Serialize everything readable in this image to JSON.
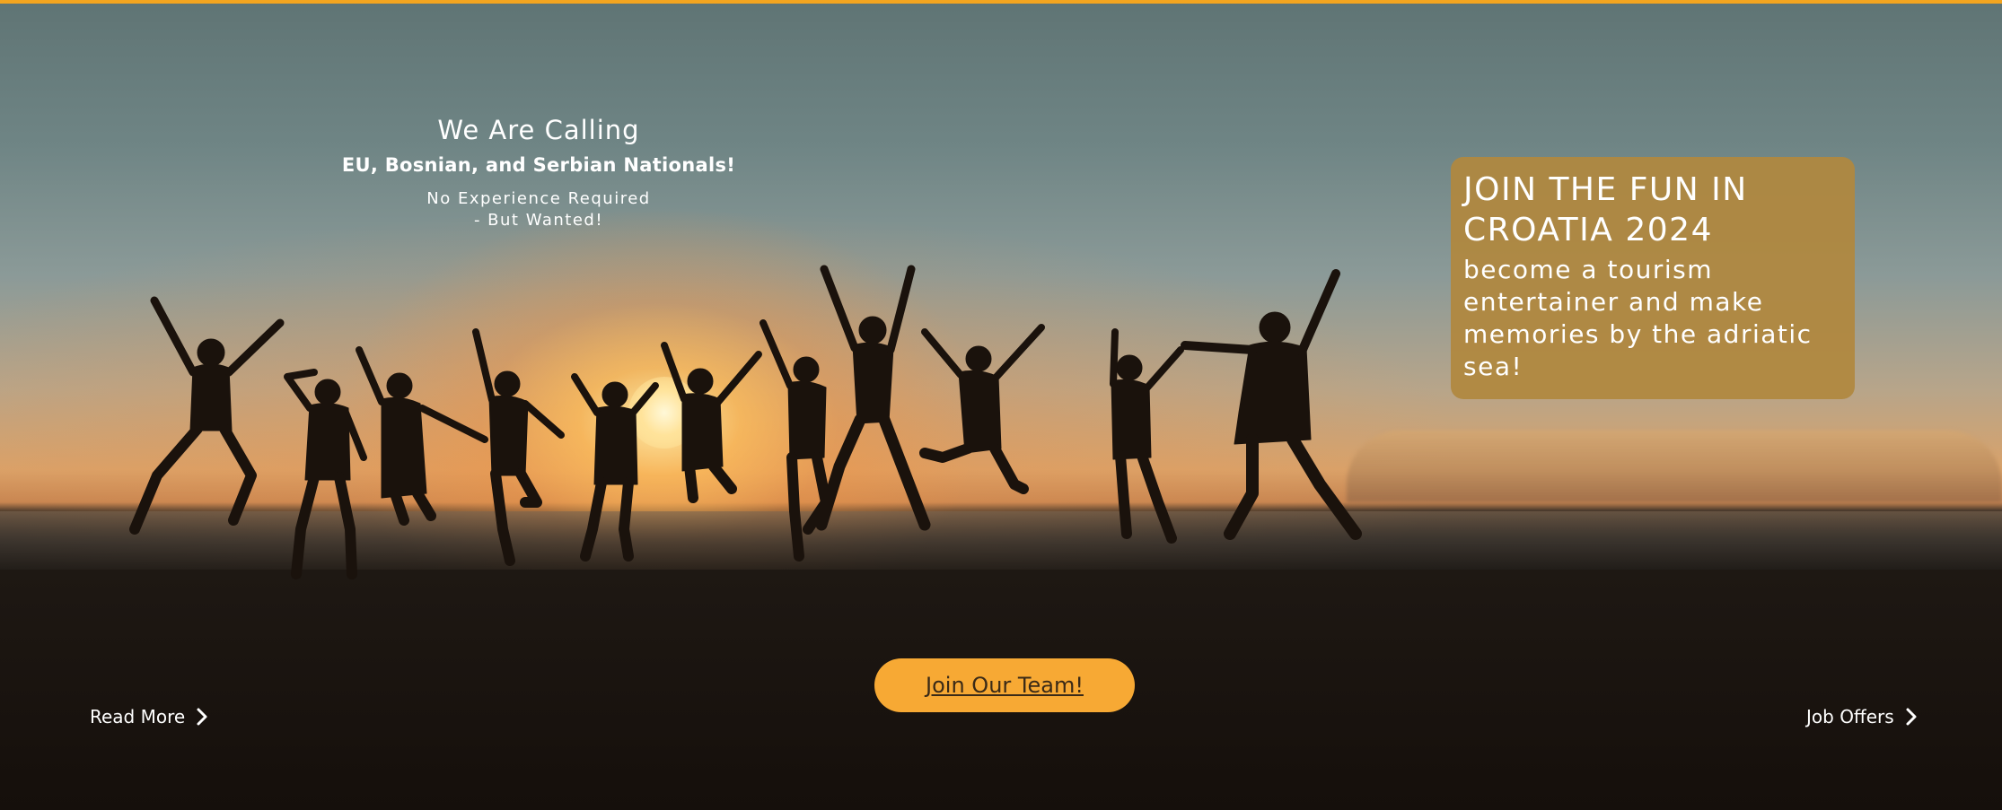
{
  "hero": {
    "calling": {
      "title": "We Are Calling",
      "subtitle": "EU, Bosnian, and Serbian Nationals!",
      "note_line1": "No Experience Required",
      "note_line2": "- But Wanted!"
    },
    "promo": {
      "title": "JOIN THE FUN IN CROATIA 2024",
      "text": "become a tourism entertainer and make memories by the adriatic sea!"
    },
    "cta_label": "Join Our Team!",
    "read_more_label": "Read More",
    "job_offers_label": "Job Offers"
  },
  "colors": {
    "accent": "#f4a51f",
    "button": "#f7a934",
    "card": "#b0883e"
  },
  "icons": {
    "read_more": "chevron-right-icon",
    "job_offers": "chevron-right-icon"
  }
}
